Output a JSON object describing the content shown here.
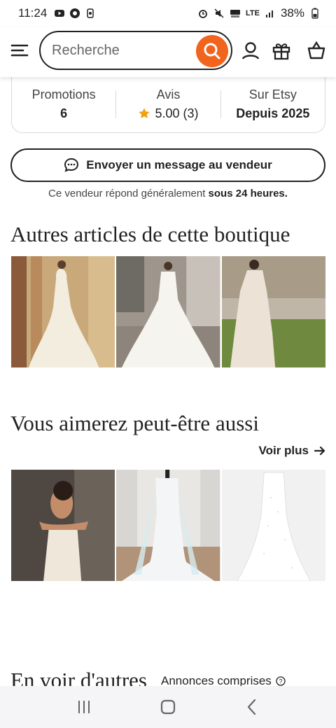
{
  "status_bar": {
    "time": "11:24",
    "network": "LTE",
    "battery": "38%"
  },
  "header": {
    "search_placeholder": "Recherche",
    "icons": [
      "menu-icon",
      "search-icon",
      "account-icon",
      "gift-icon",
      "cart-icon"
    ],
    "accent_color": "#f1641e"
  },
  "shop_stats": [
    {
      "label": "Promotions",
      "value": "6"
    },
    {
      "label": "Avis",
      "value": "5.00 (3)",
      "icon": "star-icon"
    },
    {
      "label": "Sur Etsy",
      "value": "Depuis 2025"
    }
  ],
  "message_button": {
    "label": "Envoyer un message au vendeur"
  },
  "reply_note": {
    "prefix": "Ce vendeur répond généralement ",
    "bold": "sous 24 heures."
  },
  "section_shop_items": {
    "title": "Autres articles de cette boutique",
    "items": [
      "wedding-dress-mermaid-lace",
      "wedding-dress-satin-ballgown",
      "wedding-dress-lace-long-sleeve"
    ]
  },
  "section_recommended": {
    "title": "Vous aimerez peut-être aussi",
    "see_more": "Voir plus",
    "items": [
      "wedding-dress-satin-model",
      "wedding-dress-mannequin-train",
      "wedding-dress-sparkle-tulle"
    ]
  },
  "section_more": {
    "title": "En voir d'autres",
    "subtitle": "Annonces comprises"
  },
  "nav_bar": {
    "icons": [
      "recent-apps-icon",
      "home-icon",
      "back-icon"
    ]
  }
}
